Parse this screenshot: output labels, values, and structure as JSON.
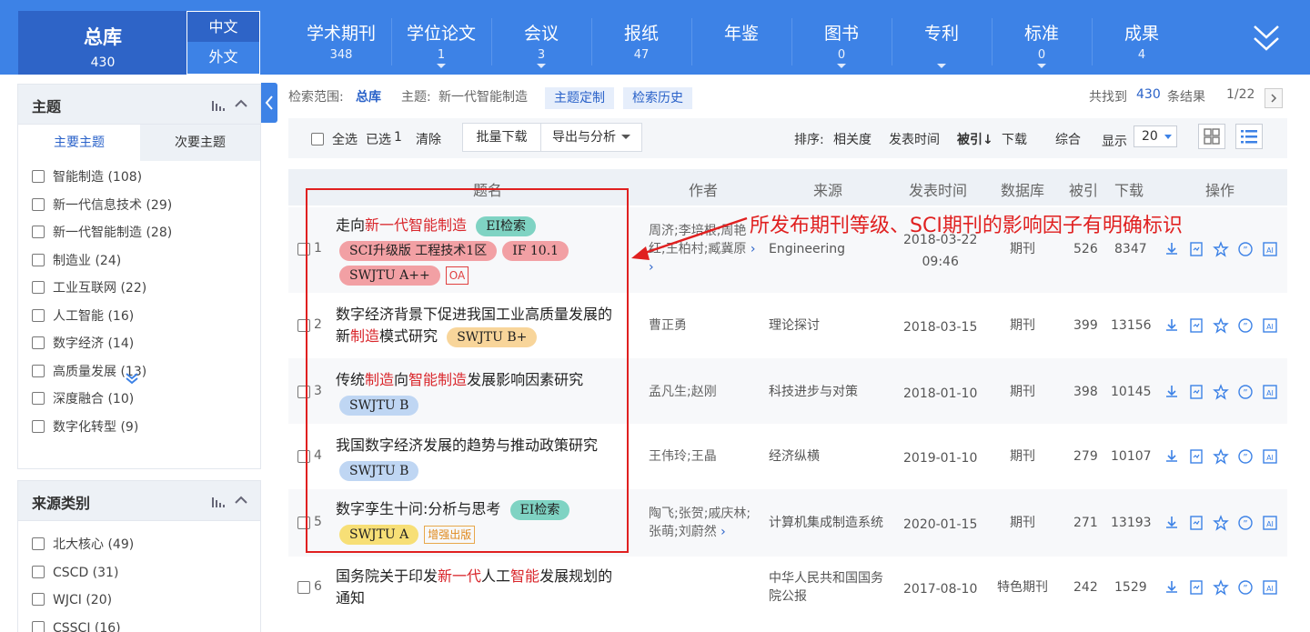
{
  "nav": {
    "main": {
      "label": "总库",
      "count": "430"
    },
    "lang": [
      "中文",
      "外文"
    ],
    "items": [
      {
        "label": "学术期刊",
        "count": "348"
      },
      {
        "label": "学位论文",
        "count": "1"
      },
      {
        "label": "会议",
        "count": "3"
      },
      {
        "label": "报纸",
        "count": "47"
      },
      {
        "label": "年鉴",
        "count": ""
      },
      {
        "label": "图书",
        "count": "0"
      },
      {
        "label": "专利",
        "count": ""
      },
      {
        "label": "标准",
        "count": "0"
      },
      {
        "label": "成果",
        "count": "4"
      }
    ]
  },
  "sidebar": {
    "topic": {
      "title": "主题",
      "tabs": [
        "主要主题",
        "次要主题"
      ],
      "items": [
        "智能制造 (108)",
        "新一代信息技术 (29)",
        "新一代智能制造 (28)",
        "制造业 (24)",
        "工业互联网 (22)",
        "人工智能 (16)",
        "数字经济 (14)",
        "高质量发展 (13)",
        "深度融合 (10)",
        "数字化转型 (9)"
      ]
    },
    "source": {
      "title": "来源类别",
      "items": [
        "北大核心 (49)",
        "CSCD (31)",
        "WJCI (20)",
        "CSSCI (16)"
      ]
    }
  },
  "search": {
    "scope_label": "检索范围:",
    "scope_value": "总库",
    "topic_label": "主题:",
    "topic_value": "新一代智能制造",
    "btn_custom": "主题定制",
    "btn_history": "检索历史",
    "found_prefix": "共找到",
    "found_count": "430",
    "found_suffix": "条结果",
    "page": "1/22"
  },
  "toolbar": {
    "select_all": "全选",
    "selected_label": "已选",
    "selected_count": "1",
    "clear": "清除",
    "batch_download": "批量下载",
    "export": "导出与分析",
    "sort_label": "排序:",
    "sort_options": [
      "相关度",
      "发表时间",
      "被引",
      "下载",
      "综合"
    ],
    "display_label": "显示",
    "display_value": "20"
  },
  "table": {
    "headers": [
      "题名",
      "作者",
      "来源",
      "发表时间",
      "数据库",
      "被引",
      "下载",
      "操作"
    ],
    "rows": [
      {
        "no": "1",
        "title": [
          {
            "t": "走向"
          },
          {
            "t": "新一代智能制造",
            "hl": true
          }
        ],
        "badges": [
          {
            "t": "EI检索",
            "c": "b-green"
          },
          {
            "t": "SCI升级版 工程技术1区",
            "c": "b-pink"
          },
          {
            "t": "IF 10.1",
            "c": "b-pink"
          },
          {
            "t": "SWJTU A++",
            "c": "b-pink"
          },
          {
            "t": "OA",
            "c": "b-oa"
          }
        ],
        "author": [
          "周济;李培根;周艳",
          "红;王柏村;臧冀原"
        ],
        "source": "Engineering",
        "date": [
          "2018-03-22",
          "09:46"
        ],
        "db": "期刊",
        "cited": "526",
        "downloads": "8347"
      },
      {
        "no": "2",
        "title": [
          {
            "t": "数字经济背景下促进我国工业高质量发展的"
          },
          {
            "br": true
          },
          {
            "t": "新"
          },
          {
            "t": "制造",
            "hl": true
          },
          {
            "t": "模式研究"
          }
        ],
        "badges": [
          {
            "t": "SWJTU B+",
            "c": "b-orange"
          }
        ],
        "author": [
          "曹正勇"
        ],
        "source": "理论探讨",
        "date": [
          "2018-03-15"
        ],
        "db": "期刊",
        "cited": "399",
        "downloads": "13156"
      },
      {
        "no": "3",
        "title": [
          {
            "t": "传统"
          },
          {
            "t": "制造",
            "hl": true
          },
          {
            "t": "向"
          },
          {
            "t": "智能制造",
            "hl": true
          },
          {
            "t": "发展影响因素研究"
          }
        ],
        "badges": [
          {
            "t": "SWJTU B",
            "c": "b-blue"
          }
        ],
        "author": [
          "孟凡生;赵刚"
        ],
        "source": "科技进步与对策",
        "date": [
          "2018-01-10"
        ],
        "db": "期刊",
        "cited": "398",
        "downloads": "10145"
      },
      {
        "no": "4",
        "title": [
          {
            "t": "我国数字经济发展的趋势与推动政策研究"
          }
        ],
        "badges": [
          {
            "t": "SWJTU B",
            "c": "b-blue"
          }
        ],
        "author": [
          "王伟玲;王晶"
        ],
        "source": "经济纵横",
        "date": [
          "2019-01-10"
        ],
        "db": "期刊",
        "cited": "279",
        "downloads": "10107"
      },
      {
        "no": "5",
        "title": [
          {
            "t": "数字孪生十问:分析与思考"
          }
        ],
        "badges": [
          {
            "t": "EI检索",
            "c": "b-green"
          },
          {
            "t": "SWJTU A",
            "c": "b-yellow"
          },
          {
            "t": "增强出版",
            "c": "b-enh"
          }
        ],
        "author": [
          "陶飞;张贺;戚庆林;",
          "张萌;刘蔚然"
        ],
        "source": "计算机集成制造系统",
        "date": [
          "2020-01-15"
        ],
        "db": "期刊",
        "cited": "271",
        "downloads": "13193"
      },
      {
        "no": "6",
        "title": [
          {
            "t": "国务院关于印发"
          },
          {
            "t": "新一代",
            "hl": true
          },
          {
            "t": "人工"
          },
          {
            "t": "智能",
            "hl": true
          },
          {
            "t": "发展规划的"
          },
          {
            "br": true
          },
          {
            "t": "通知"
          }
        ],
        "badges": [],
        "author": [],
        "source": "中华人民共和国国务院公报",
        "date": [
          "2017-08-10"
        ],
        "db": "特色期刊",
        "cited": "242",
        "downloads": "1529"
      }
    ]
  },
  "annotation": "所发布期刊等级、SCI期刊的影响因子有明确标识",
  "colors": {
    "nav": "#3d82e6",
    "nav_active": "#2e64c7",
    "highlight": "#d9262b",
    "annotation": "#e02020"
  },
  "icons": [
    "download-icon",
    "read-icon",
    "star-icon",
    "cite-icon",
    "ai-icon",
    "chevron-down-icon",
    "bar-chart-icon",
    "chevron-up-icon"
  ]
}
